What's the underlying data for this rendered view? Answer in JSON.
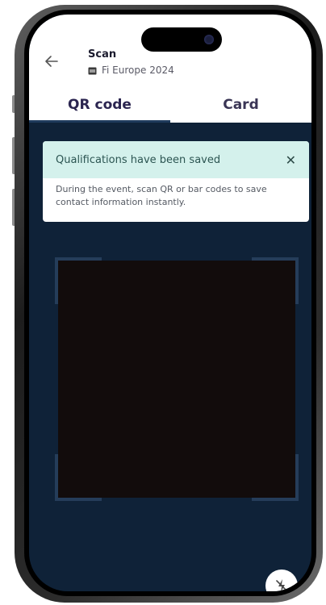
{
  "header": {
    "title": "Scan",
    "event_name": "Fi Europe 2024"
  },
  "tabs": [
    {
      "label": "QR code",
      "active": true
    },
    {
      "label": "Card",
      "active": false
    }
  ],
  "toast": {
    "title": "Qualifications have been saved",
    "close_symbol": "✕",
    "message": "During the event, scan QR or bar codes to save contact information instantly."
  },
  "colors": {
    "screen_background": "#0f2238",
    "toast_header": "#d4f1ec",
    "scanner_area": "#120c0c",
    "tab_underline": "#1f3b5c"
  },
  "icons": {
    "back": "arrow-left-icon",
    "event": "calendar-icon",
    "flash": "flash-off-icon"
  }
}
